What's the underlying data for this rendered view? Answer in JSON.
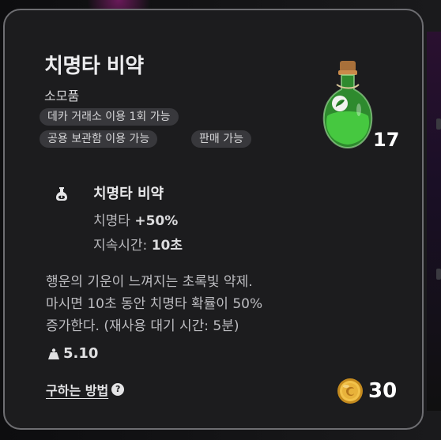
{
  "item": {
    "name": "치명타 비약",
    "category": "소모품",
    "quantity": "17",
    "tags": [
      "데카 거래소 이용 1회 가능",
      "공용 보관함 이용 가능",
      "판매 가능"
    ],
    "effect": {
      "icon": "flask-icon",
      "name": "치명타 비약",
      "stat_label": "치명타",
      "stat_value": "+50%",
      "duration_label": "지속시간:",
      "duration_value": "10초"
    },
    "description_lines": [
      "행운의 기운이 느껴지는 초록빛 약제.",
      "마시면 10초 동안 치명타 확률이 50%",
      "증가한다. (재사용 대기 시간: 5분)"
    ],
    "weight": "5.10",
    "how_to_obtain": "구하는 방법",
    "price": "30"
  },
  "colors": {
    "card_bg": "#1c1c1e",
    "card_border": "#6e6e72",
    "tag_bg": "#38383c",
    "potion_green": "#3fbf3a",
    "coin_gold": "#e8b23a"
  },
  "icons": {
    "potion": "potion-bottle-icon",
    "weight": "weight-icon",
    "help": "question-circle-icon",
    "coin": "gold-coin-icon"
  }
}
